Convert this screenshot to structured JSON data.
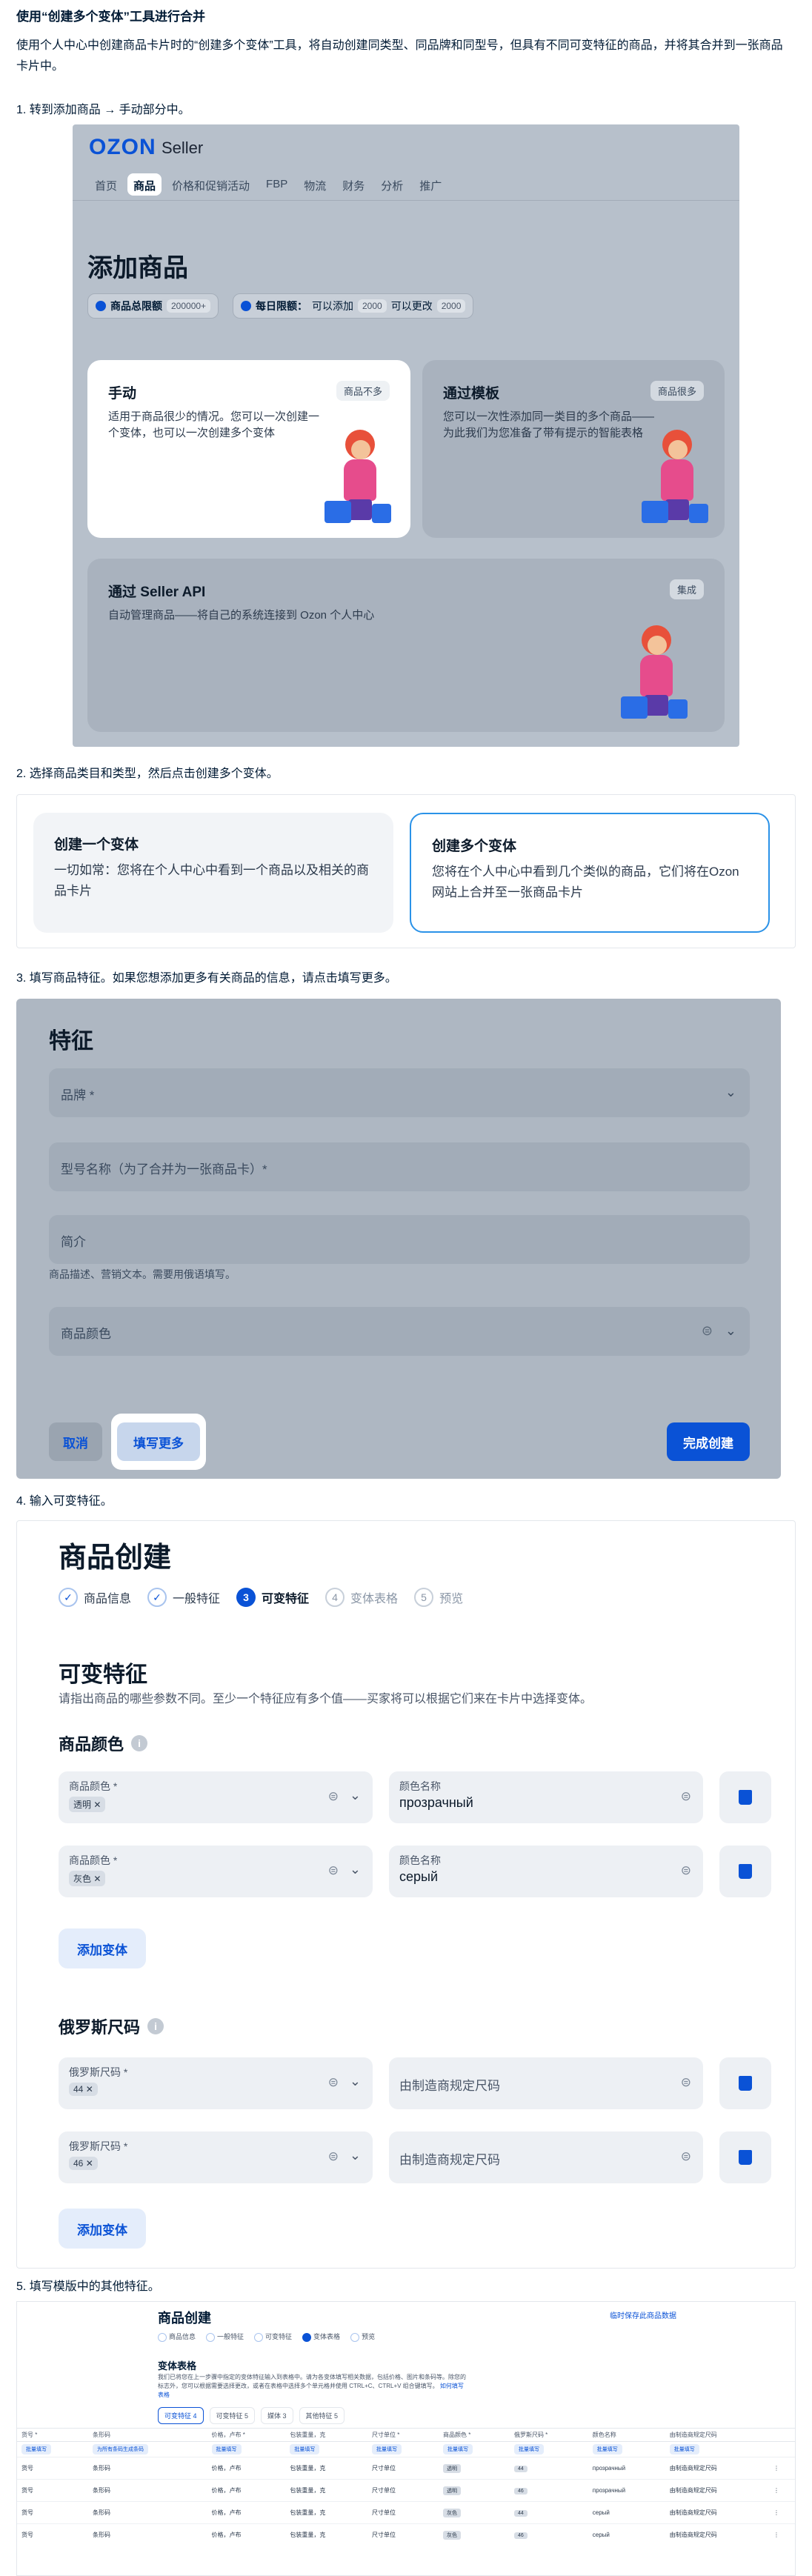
{
  "title": "使用“创建多个变体”工具进行合并",
  "intro": "使用个人中心中创建商品卡片时的“创建多个变体”工具，将自动创建同类型、同品牌和同型号，但具有不同可变特征的商品，并将其合并到一张商品卡片中。",
  "steps": {
    "s1": "1. 转到添加商品 → 手动部分中。",
    "s2": "2. 选择商品类目和类型，然后点击创建多个变体。",
    "s3": "3. 填写商品特征。如果您想添加更多有关商品的信息，请点击填写更多。",
    "s4": "4. 输入可变特征。",
    "s5": "5. 填写模版中的其他特征。"
  },
  "s1": {
    "logo": "OZON",
    "seller": "Seller",
    "nav": [
      "首页",
      "商品",
      "价格和促销活动",
      "FBP",
      "物流",
      "财务",
      "分析",
      "推广"
    ],
    "heading": "添加商品",
    "limit_total_label": "商品总限额",
    "limit_total_value": "200000+",
    "limit_daily_label": "每日限额：",
    "limit_daily_add": "可以添加",
    "limit_daily_add_value": "2000",
    "limit_daily_edit": "可以更改",
    "limit_daily_edit_value": "2000",
    "card_manual_title": "手动",
    "card_manual_tag": "商品不多",
    "card_manual_desc": "适用于商品很少的情况。您可以一次创建一个变体，也可以一次创建多个变体",
    "card_template_title": "通过模板",
    "card_template_tag": "商品很多",
    "card_template_desc": "您可以一次性添加同一类目的多个商品——为此我们为您准备了带有提示的智能表格",
    "card_api_title": "通过 Seller API",
    "card_api_tag": "集成",
    "card_api_desc": "自动管理商品——将自己的系统连接到 Ozon 个人中心"
  },
  "s2": {
    "one_title": "创建一个变体",
    "one_desc": "一切如常：您将在个人中心中看到一个商品以及相关的商品卡片",
    "many_title": "创建多个变体",
    "many_desc": "您将在个人中心中看到几个类似的商品，它们将在Ozon网站上合并至一张商品卡片"
  },
  "s3": {
    "heading": "特征",
    "brand": "品牌 *",
    "model": "型号名称（为了合并为一张商品卡）*",
    "summary": "简介",
    "summary_hint": "商品描述、营销文本。需要用俄语填写。",
    "color": "商品颜色",
    "cancel": "取消",
    "more": "填写更多",
    "done": "完成创建"
  },
  "s4": {
    "heading": "商品创建",
    "stepper": [
      {
        "n": "✓",
        "label": "商品信息",
        "state": "done"
      },
      {
        "n": "✓",
        "label": "一般特征",
        "state": "done"
      },
      {
        "n": "3",
        "label": "可变特征",
        "state": "cur"
      },
      {
        "n": "4",
        "label": "变体表格",
        "state": "fut"
      },
      {
        "n": "5",
        "label": "预览",
        "state": "fut"
      }
    ],
    "section": "可变特征",
    "desc": "请指出商品的哪些参数不同。至少一个特征应有多个值——买家将可以根据它们来在卡片中选择变体。",
    "color_group": "商品颜色",
    "color_label": "商品颜色 *",
    "color_chip1": "透明",
    "color_chip2": "灰色",
    "color_name_label": "颜色名称",
    "color_name1": "прозрачный",
    "color_name2": "серый",
    "add_variant": "添加变体",
    "size_group": "俄罗斯尺码",
    "size_label": "俄罗斯尺码 *",
    "size_chip1": "44",
    "size_chip2": "46",
    "size_ph": "由制造商规定尺码"
  },
  "s5": {
    "heading": "商品创建",
    "link": "临时保存此商品数据",
    "stepper": [
      "商品信息",
      "一般特征",
      "可变特征",
      "变体表格",
      "预览"
    ],
    "section": "变体表格",
    "desc": "我们已将您在上一步骤中指定的变体特征输入到表格中。请为各变体填写相关数据，包括价格、图片和条码等。除您的标志外，您可以根据需要选择更改，或者在表格中选择多个单元格并使用 CTRL+C、CTRL+V 组合键填写。",
    "desc_link": "如何填写表格",
    "tabs": [
      "可变特征 4",
      "可变特征 5",
      "媒体 3",
      "其他特征 5"
    ],
    "columns": [
      "货号 *",
      "条形码",
      "价格，卢布 *",
      "包装重量，克",
      "尺寸单位 *",
      "商品颜色 *",
      "俄罗斯尺码 *",
      "颜色名称",
      "由制造商规定尺码"
    ],
    "fill_all": "批量填写",
    "gen_barcode": "为所有条码生成条码",
    "rows": [
      {
        "sku": "货号",
        "barcode": "条形码",
        "price": "价格，卢布",
        "weight": "包装重量，克",
        "unit": "尺寸单位",
        "color": "透明",
        "size": "44",
        "cname": "прозрачный",
        "msize": "由制造商规定尺码"
      },
      {
        "sku": "货号",
        "barcode": "条形码",
        "price": "价格，卢布",
        "weight": "包装重量，克",
        "unit": "尺寸单位",
        "color": "透明",
        "size": "46",
        "cname": "прозрачный",
        "msize": "由制造商规定尺码"
      },
      {
        "sku": "货号",
        "barcode": "条形码",
        "price": "价格，卢布",
        "weight": "包装重量，克",
        "unit": "尺寸单位",
        "color": "灰色",
        "size": "44",
        "cname": "серый",
        "msize": "由制造商规定尺码"
      },
      {
        "sku": "货号",
        "barcode": "条形码",
        "price": "价格，卢布",
        "weight": "包装重量，克",
        "unit": "尺寸单位",
        "color": "灰色",
        "size": "46",
        "cname": "серый",
        "msize": "由制造商规定尺码"
      }
    ]
  },
  "colors": {
    "accent": "#0a52d6",
    "selected_border": "#2a92e8",
    "overlay": "#b7c0cb"
  }
}
